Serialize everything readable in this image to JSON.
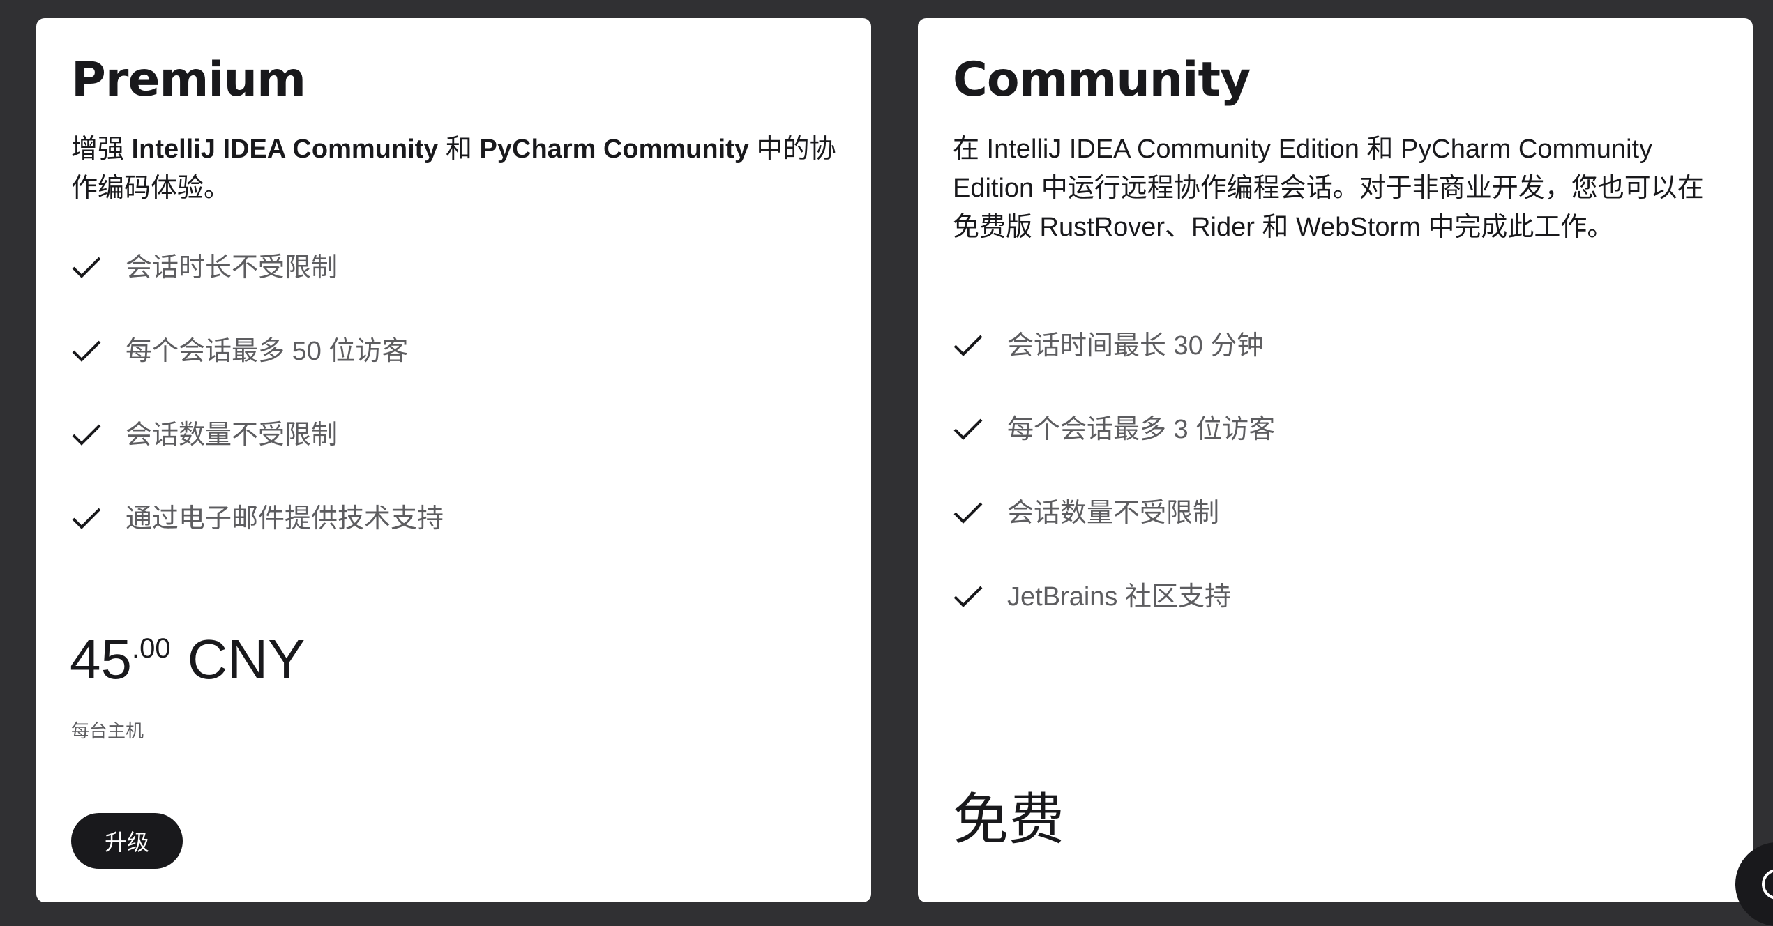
{
  "plans": {
    "premium": {
      "title": "Premium",
      "description": {
        "prefix": "增强 ",
        "product1": "IntelliJ IDEA Community",
        "connector": " 和 ",
        "product2": "PyCharm Community",
        "suffix": " 中的协作编码体验。"
      },
      "features": [
        "会话时长不受限制",
        "每个会话最多 50 位访客",
        "会话数量不受限制",
        "通过电子邮件提供技术支持"
      ],
      "price": {
        "integer": "45",
        "decimal": ".00",
        "currency": "CNY",
        "note": "每台主机"
      },
      "button_label": "升级"
    },
    "community": {
      "title": "Community",
      "description": "在 IntelliJ IDEA Community Edition 和 PyCharm Community Edition 中运行远程协作编程会话。对于非商业开发，您也可以在免费版 RustRover、Rider 和 WebStorm 中完成此工作。",
      "features": [
        "会话时间最长 30 分钟",
        "每个会话最多 3 位访客",
        "会话数量不受限制",
        "JetBrains 社区支持"
      ],
      "price_label": "免费"
    }
  },
  "icons": {
    "feature": "check-icon",
    "fab": "chat-icon"
  },
  "colors": {
    "page_background": "#303033",
    "card_background": "#ffffff",
    "text_primary": "#19191c",
    "text_secondary": "#5d5d60",
    "button_background": "#19191c",
    "button_text": "#ffffff"
  }
}
